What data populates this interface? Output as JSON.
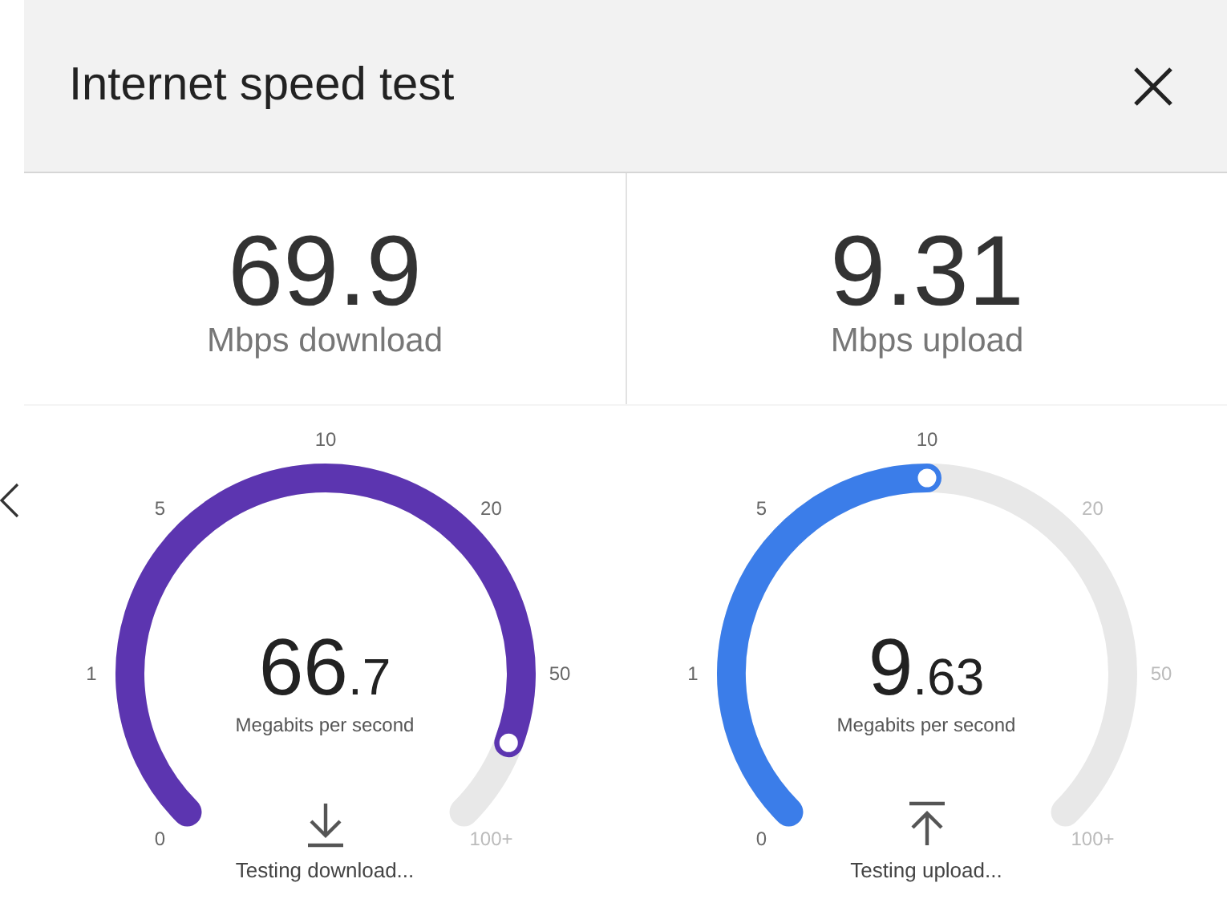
{
  "header": {
    "title": "Internet speed test"
  },
  "results": [
    {
      "value": "69.9",
      "label": "Mbps download"
    },
    {
      "value": "9.31",
      "label": "Mbps upload"
    }
  ],
  "gauges": [
    {
      "kind": "download",
      "color": "#5c35b0",
      "scale": [
        "0",
        "1",
        "5",
        "10",
        "20",
        "50",
        "100+"
      ],
      "value_main": "66",
      "value_fraction": ".7",
      "unit": "Megabits per second",
      "status": "Testing download..."
    },
    {
      "kind": "upload",
      "color": "#3b7de9",
      "scale": [
        "0",
        "1",
        "5",
        "10",
        "20",
        "50",
        "100+"
      ],
      "value_main": "9",
      "value_fraction": ".63",
      "unit": "Megabits per second",
      "status": "Testing upload..."
    }
  ]
}
